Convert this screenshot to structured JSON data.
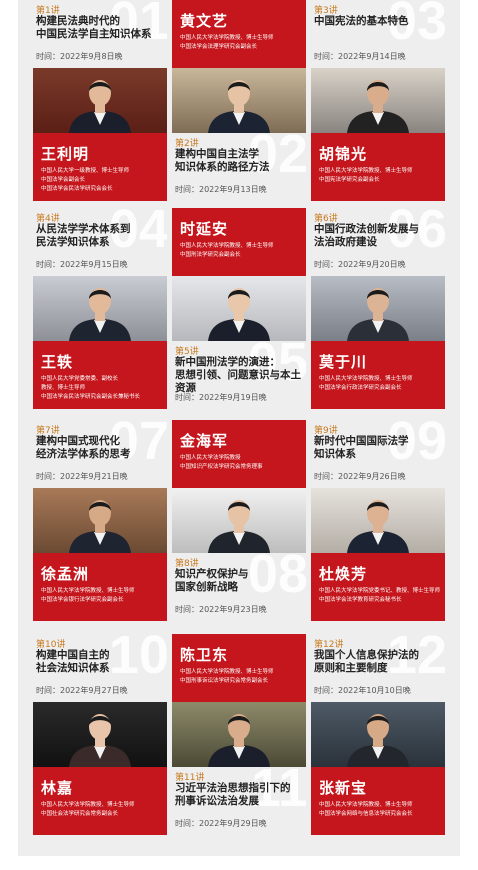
{
  "lectures": [
    {
      "no": "第1讲",
      "big": "01",
      "title": "构建民法典时代的\n中国民法学自主知识体系",
      "time": "时间：2022年9月8日晚",
      "name": "王利明",
      "info": [
        "中国人民大学一级教授、博士生导师",
        "中国法学会副会长",
        "中国法学会民法学研究会会长"
      ]
    },
    {
      "no": "第2讲",
      "big": "02",
      "title": "建构中国自主法学\n知识体系的路径方法",
      "time": "时间：2022年9月13日晚",
      "name": "黄文艺",
      "info": [
        "中国人民大学法学院教授、博士生导师",
        "中国法学会法理学研究会副会长"
      ]
    },
    {
      "no": "第3讲",
      "big": "03",
      "title": "中国宪法的基本特色",
      "time": "时间：2022年9月14日晚",
      "name": "胡锦光",
      "info": [
        "中国人民大学法学院教授、博士生导师",
        "中国宪法学研究会副会长"
      ]
    },
    {
      "no": "第4讲",
      "big": "04",
      "title": "从民法学学术体系到\n民法学知识体系",
      "time": "时间：2022年9月15日晚",
      "name": "王轶",
      "info": [
        "中国人民大学党委常委、副校长",
        "教授、博士生导师",
        "中国法学会民法学研究会副会长兼秘书长"
      ]
    },
    {
      "no": "第5讲",
      "big": "05",
      "title": "新中国刑法学的演进：\n思想引领、问题意识与本土资源",
      "time": "时间：2022年9月19日晚",
      "name": "时延安",
      "info": [
        "中国人民大学法学院教授、博士生导师",
        "中国刑法学研究会副会长"
      ]
    },
    {
      "no": "第6讲",
      "big": "06",
      "title": "中国行政法创新发展与\n法治政府建设",
      "time": "时间：2022年9月20日晚",
      "name": "莫于川",
      "info": [
        "中国人民大学法学院教授、博士生导师",
        "中国法学会行政法学研究会副会长"
      ]
    },
    {
      "no": "第7讲",
      "big": "07",
      "title": "建构中国式现代化\n经济法学体系的思考",
      "time": "时间：2022年9月21日晚",
      "name": "徐孟洲",
      "info": [
        "中国人民大学法学院教授、博士生导师",
        "中国法学会银行法学研究会副会长"
      ]
    },
    {
      "no": "第8讲",
      "big": "08",
      "title": "知识产权保护与\n国家创新战略",
      "time": "时间：2022年9月23日晚",
      "name": "金海军",
      "info": [
        "中国人民大学法学院教授",
        "中国知识产权法学研究会常务理事"
      ]
    },
    {
      "no": "第9讲",
      "big": "09",
      "title": "新时代中国国际法学\n知识体系",
      "time": "时间：2022年9月26日晚",
      "name": "杜焕芳",
      "info": [
        "中国人民大学法学院党委书记、教授、博士生导师",
        "中国法学会法学教育研究会秘书长"
      ]
    },
    {
      "no": "第10讲",
      "big": "10",
      "title": "构建中国自主的\n社会法知识体系",
      "time": "时间：2022年9月27日晚",
      "name": "林嘉",
      "info": [
        "中国人民大学法学院教授、博士生导师",
        "中国社会法学研究会常务副会长"
      ]
    },
    {
      "no": "第11讲",
      "big": "11",
      "title": "习近平法治思想指引下的\n刑事诉讼法治发展",
      "time": "时间：2022年9月29日晚",
      "name": "陈卫东",
      "info": [
        "中国人民大学法学院教授、博士生导师",
        "中国刑事诉讼法学研究会常务副会长"
      ]
    },
    {
      "no": "第12讲",
      "big": "12",
      "title": "我国个人信息保护法的\n原则和主要制度",
      "time": "时间：2022年10月10日晚",
      "name": "张新宝",
      "info": [
        "中国人民大学法学院教授、博士生导师",
        "中国法学会网络与信息法学研究会会长"
      ]
    }
  ],
  "colors": {
    "accent": "#c4161c",
    "number": "#c8791f",
    "panel": "#eeeeee"
  }
}
